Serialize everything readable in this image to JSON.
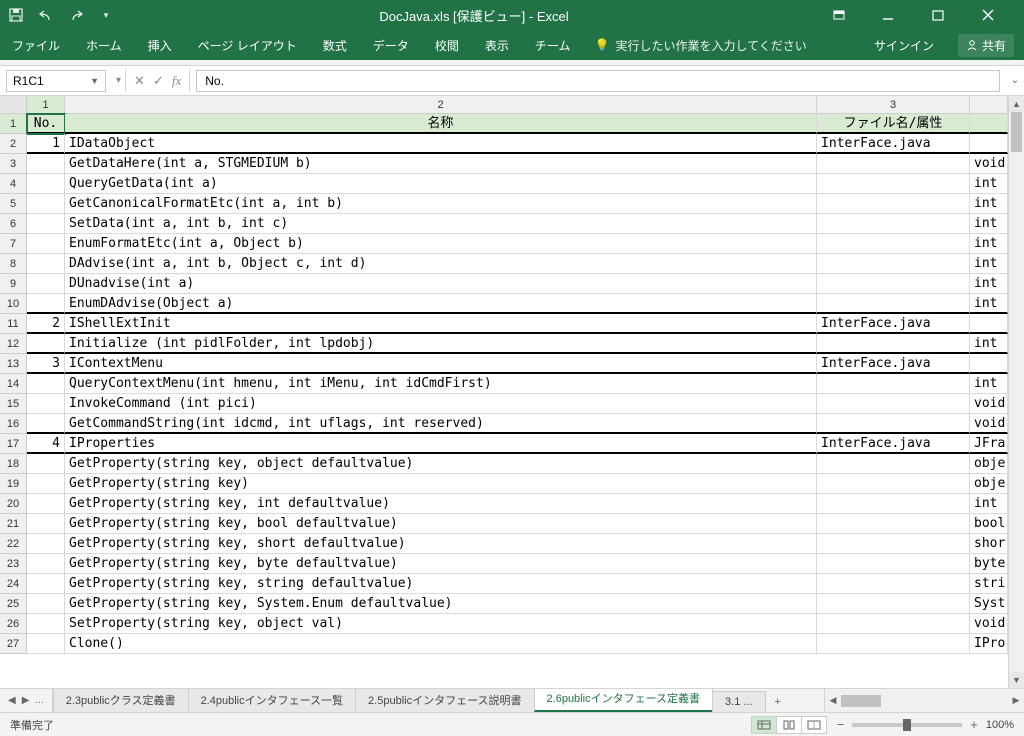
{
  "title": "DocJava.xls  [保護ビュー] - Excel",
  "ribbon": {
    "file": "ファイル",
    "home": "ホーム",
    "insert": "挿入",
    "pagelayout": "ページ レイアウト",
    "formulas": "数式",
    "data": "データ",
    "review": "校閲",
    "view": "表示",
    "team": "チーム",
    "tellme": "実行したい作業を入力してください",
    "signin": "サインイン",
    "share": "共有"
  },
  "nameBox": "R1C1",
  "formulaValue": "No.",
  "colLabels": [
    "1",
    "2",
    "3"
  ],
  "headerRow": {
    "no": "No.",
    "name": "名称",
    "file": "ファイル名/属性"
  },
  "rows": [
    {
      "r": "1",
      "no": "",
      "name": "",
      "file": "",
      "ret": "",
      "header": true
    },
    {
      "r": "2",
      "no": "1",
      "name": "IDataObject",
      "file": "InterFace.java",
      "ret": "",
      "bb": true
    },
    {
      "r": "3",
      "no": "",
      "name": "GetDataHere(int a, STGMEDIUM b)",
      "file": "",
      "ret": "void"
    },
    {
      "r": "4",
      "no": "",
      "name": "QueryGetData(int a)",
      "file": "",
      "ret": "int"
    },
    {
      "r": "5",
      "no": "",
      "name": "GetCanonicalFormatEtc(int a, int b)",
      "file": "",
      "ret": "int"
    },
    {
      "r": "6",
      "no": "",
      "name": "SetData(int a, int b, int c)",
      "file": "",
      "ret": "int"
    },
    {
      "r": "7",
      "no": "",
      "name": "EnumFormatEtc(int a, Object b)",
      "file": "",
      "ret": "int"
    },
    {
      "r": "8",
      "no": "",
      "name": "DAdvise(int a, int b, Object c, int d)",
      "file": "",
      "ret": "int"
    },
    {
      "r": "9",
      "no": "",
      "name": "DUnadvise(int a)",
      "file": "",
      "ret": "int"
    },
    {
      "r": "10",
      "no": "",
      "name": "EnumDAdvise(Object a)",
      "file": "",
      "ret": "int",
      "bb": true
    },
    {
      "r": "11",
      "no": "2",
      "name": "IShellExtInit",
      "file": "InterFace.java",
      "ret": "",
      "bb": true
    },
    {
      "r": "12",
      "no": "",
      "name": "Initialize (int pidlFolder, int lpdobj)",
      "file": "",
      "ret": "int",
      "bb": true
    },
    {
      "r": "13",
      "no": "3",
      "name": "IContextMenu",
      "file": "InterFace.java",
      "ret": "",
      "bb": true
    },
    {
      "r": "14",
      "no": "",
      "name": "QueryContextMenu(int hmenu, int iMenu, int idCmdFirst)",
      "file": "",
      "ret": "int"
    },
    {
      "r": "15",
      "no": "",
      "name": "InvokeCommand (int pici)",
      "file": "",
      "ret": "void"
    },
    {
      "r": "16",
      "no": "",
      "name": "GetCommandString(int idcmd, int uflags, int reserved)",
      "file": "",
      "ret": "void",
      "bb": true
    },
    {
      "r": "17",
      "no": "4",
      "name": "IProperties",
      "file": "InterFace.java",
      "ret": "JFra",
      "bb": true
    },
    {
      "r": "18",
      "no": "",
      "name": "GetProperty(string key, object defaultvalue)",
      "file": "",
      "ret": "obje"
    },
    {
      "r": "19",
      "no": "",
      "name": "GetProperty(string key)",
      "file": "",
      "ret": "obje"
    },
    {
      "r": "20",
      "no": "",
      "name": "GetProperty(string key, int defaultvalue)",
      "file": "",
      "ret": "int"
    },
    {
      "r": "21",
      "no": "",
      "name": "GetProperty(string key, bool defaultvalue)",
      "file": "",
      "ret": "bool"
    },
    {
      "r": "22",
      "no": "",
      "name": "GetProperty(string key, short defaultvalue)",
      "file": "",
      "ret": "shor"
    },
    {
      "r": "23",
      "no": "",
      "name": "GetProperty(string key, byte defaultvalue)",
      "file": "",
      "ret": "byte"
    },
    {
      "r": "24",
      "no": "",
      "name": "GetProperty(string key, string defaultvalue)",
      "file": "",
      "ret": "stri"
    },
    {
      "r": "25",
      "no": "",
      "name": "GetProperty(string key, System.Enum defaultvalue)",
      "file": "",
      "ret": "Syst"
    },
    {
      "r": "26",
      "no": "",
      "name": "SetProperty(string key, object val)",
      "file": "",
      "ret": "void"
    },
    {
      "r": "27",
      "no": "",
      "name": "Clone()",
      "file": "",
      "ret": "IPro"
    }
  ],
  "sheetTabs": {
    "prev": "...",
    "t1": "2.3publicクラス定義書",
    "t2": "2.4publicインタフェース一覧",
    "t3": "2.5publicインタフェース説明書",
    "t4": "2.6publicインタフェース定義書",
    "t5": "3.1 ...",
    "add": "+"
  },
  "status": {
    "ready": "準備完了",
    "zoom": "100%"
  }
}
